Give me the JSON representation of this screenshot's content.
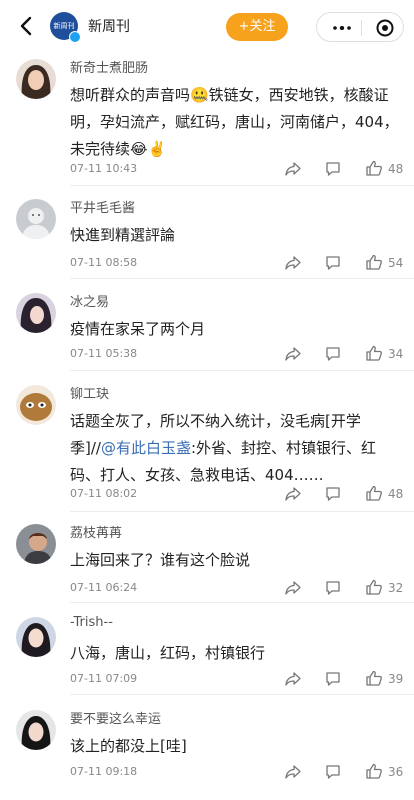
{
  "header": {
    "title": "新周刊",
    "logo_text": "新周刊",
    "follow_label": "+关注"
  },
  "comments": [
    {
      "name": "新奇士煮肥肠",
      "text": "想听群众的声音吗🤐铁链女，西安地铁，核酸证明，孕妇流产，赋红码，唐山，河南储户，404，未完待续😂✌️",
      "time": "07-11 10:43",
      "likes": "48"
    },
    {
      "name": "平井毛毛酱",
      "text": "快進到精選評論",
      "time": "07-11 08:58",
      "likes": "54"
    },
    {
      "name": "冰之易",
      "text": "疫情在家呆了两个月",
      "time": "07-11 05:38",
      "likes": "34"
    },
    {
      "name": "铆工玦",
      "text_before": "话题全灰了，所以不纳入统计，没毛病[开学季]//",
      "mention": "@有此白玉盏",
      "text_after": ":外省、封控、村镇银行、红码、打人、女孩、急救电话、404……",
      "time": "07-11 08:02",
      "likes": "48"
    },
    {
      "name": "荔枝苒苒",
      "text": "上海回来了？谁有这个脸说",
      "time": "07-11 06:24",
      "likes": "32"
    },
    {
      "name": "-Trish--",
      "text": "八海，唐山，红码，村镇银行",
      "time": "07-11 07:09",
      "likes": "39"
    },
    {
      "name": "要不要这么幸运",
      "text": "该上的都没上[哇]",
      "time": "07-11 09:18",
      "likes": "36"
    }
  ]
}
